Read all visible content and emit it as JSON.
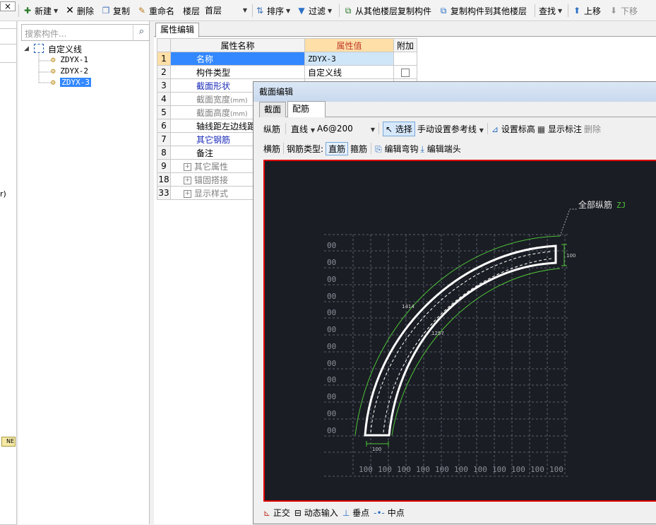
{
  "toolbar": {
    "close_label": "×",
    "new_label": "新建",
    "delete_label": "删除",
    "copy_label": "复制",
    "rename_label": "重命名",
    "floor_label": "楼层",
    "floor_value": "首层",
    "sort_label": "排序",
    "filter_label": "过滤",
    "copy_from_floor_label": "从其他楼层复制构件",
    "copy_to_floor_label": "复制构件到其他楼层",
    "find_label": "查找",
    "move_up_label": "上移",
    "move_down_label": "下移"
  },
  "left_strip": {
    "fragment_text": "r)",
    "badge_text": "NE"
  },
  "tree": {
    "search_placeholder": "搜索构件...",
    "root_label": "自定义线",
    "items": [
      "ZDYX-1",
      "ZDYX-2",
      "ZDYX-3"
    ],
    "selected_index": 2
  },
  "properties": {
    "tab_label": "属性编辑",
    "headers": {
      "name": "属性名称",
      "value": "属性值",
      "extra": "附加"
    },
    "rows": [
      {
        "num": "1",
        "name": "名称",
        "value": "ZDYX-3",
        "style": "selected"
      },
      {
        "num": "2",
        "name": "构件类型",
        "value": "自定义线",
        "style": "normal",
        "checkbox": true
      },
      {
        "num": "3",
        "name": "截面形状",
        "value": "",
        "style": "blue"
      },
      {
        "num": "4",
        "name": "截面宽度",
        "unit": "(mm)",
        "value": "",
        "style": "gray"
      },
      {
        "num": "5",
        "name": "截面高度",
        "unit": "(mm)",
        "value": "",
        "style": "gray"
      },
      {
        "num": "6",
        "name": "轴线距左边线距离",
        "value": "",
        "style": "normal"
      },
      {
        "num": "7",
        "name": "其它钢筋",
        "value": "",
        "style": "blue"
      },
      {
        "num": "8",
        "name": "备注",
        "value": "",
        "style": "normal"
      },
      {
        "num": "9",
        "name": "其它属性",
        "value": "",
        "style": "group"
      },
      {
        "num": "18",
        "name": "锚固搭接",
        "value": "",
        "style": "group"
      },
      {
        "num": "33",
        "name": "显示样式",
        "value": "",
        "style": "group"
      }
    ]
  },
  "dialog": {
    "title": "截面编辑",
    "tabs": [
      "截面",
      "配筋"
    ],
    "active_tab": 1,
    "row1": {
      "longitudinal": "纵筋",
      "line_type": "直线",
      "spec": "A6@200",
      "select": "选择",
      "manual_ref": "手动设置参考线",
      "set_elevation": "设置标高",
      "show_annotation": "显示标注",
      "delete": "删除"
    },
    "row2": {
      "transverse": "横筋",
      "type_label": "钢筋类型:",
      "straight": "直筋",
      "stirrup": "箍筋",
      "edit_bend": "编辑弯钩",
      "edit_end": "编辑端头"
    },
    "canvas": {
      "label_main": "全部纵筋",
      "label_code": "ZJ",
      "dim_outer": "1414",
      "dim_inner": "1257",
      "dim_end_right": "100",
      "dim_end_bottom": "100",
      "grid_label": "00",
      "bottom_label": "100",
      "colors": {
        "background": "#1a1d24",
        "shape": "#ffffff",
        "dimension": "#4fc23a",
        "grid": "#6a6e78",
        "frame": "#e00000"
      }
    },
    "status": {
      "ortho": "正交",
      "dynamic_input": "动态输入",
      "perpendicular": "垂点",
      "midpoint": "中点"
    }
  }
}
